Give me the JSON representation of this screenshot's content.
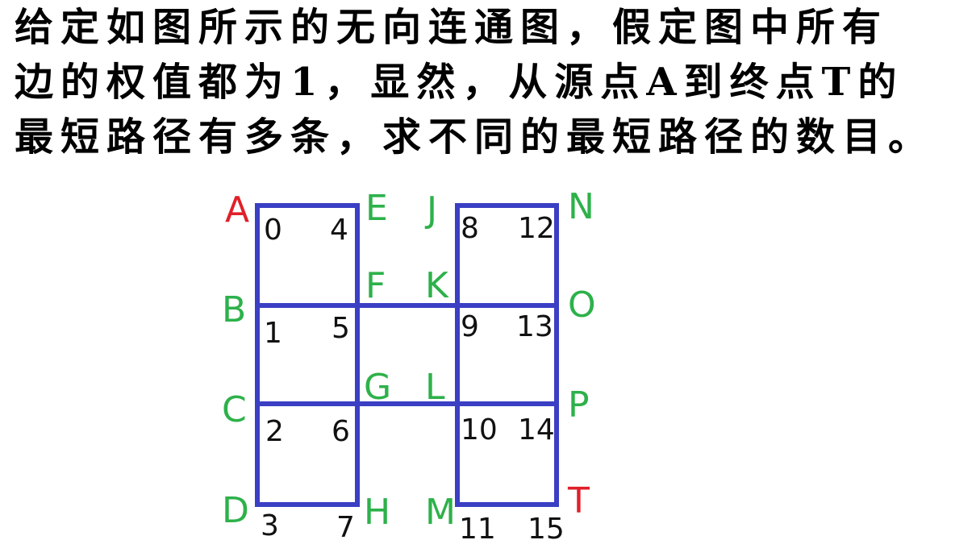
{
  "question": {
    "line1": "给定如图所示的无向连通图，假定图中所有",
    "line2": "边的权值都为1，显然，从源点A到终点T的",
    "line3": "最短路径有多条，求不同的最短路径的数目。"
  },
  "colors": {
    "edge": "#3a3fc4",
    "label_green": "#2db14a",
    "label_red": "#e0202a",
    "index_text": "#111111"
  },
  "nodes": [
    {
      "letter": "A",
      "index": "0",
      "role": "source"
    },
    {
      "letter": "B",
      "index": "1"
    },
    {
      "letter": "C",
      "index": "2"
    },
    {
      "letter": "D",
      "index": "3"
    },
    {
      "letter": "E",
      "index": "4"
    },
    {
      "letter": "F",
      "index": "5"
    },
    {
      "letter": "G",
      "index": "6"
    },
    {
      "letter": "H",
      "index": "7"
    },
    {
      "letter": "J",
      "index": "8"
    },
    {
      "letter": "K",
      "index": "9"
    },
    {
      "letter": "L",
      "index": "10"
    },
    {
      "letter": "M",
      "index": "11"
    },
    {
      "letter": "N",
      "index": "12"
    },
    {
      "letter": "O",
      "index": "13"
    },
    {
      "letter": "P",
      "index": "14"
    },
    {
      "letter": "T",
      "index": "15",
      "role": "target"
    }
  ],
  "edges": [
    [
      "A",
      "E"
    ],
    [
      "A",
      "B"
    ],
    [
      "E",
      "F"
    ],
    [
      "B",
      "F"
    ],
    [
      "B",
      "C"
    ],
    [
      "F",
      "G"
    ],
    [
      "C",
      "G"
    ],
    [
      "C",
      "D"
    ],
    [
      "G",
      "H"
    ],
    [
      "D",
      "H"
    ],
    [
      "F",
      "K"
    ],
    [
      "G",
      "L"
    ],
    [
      "J",
      "N"
    ],
    [
      "J",
      "K"
    ],
    [
      "N",
      "O"
    ],
    [
      "K",
      "O"
    ],
    [
      "K",
      "L"
    ],
    [
      "O",
      "P"
    ],
    [
      "L",
      "P"
    ],
    [
      "L",
      "M"
    ],
    [
      "P",
      "T"
    ],
    [
      "M",
      "T"
    ]
  ]
}
